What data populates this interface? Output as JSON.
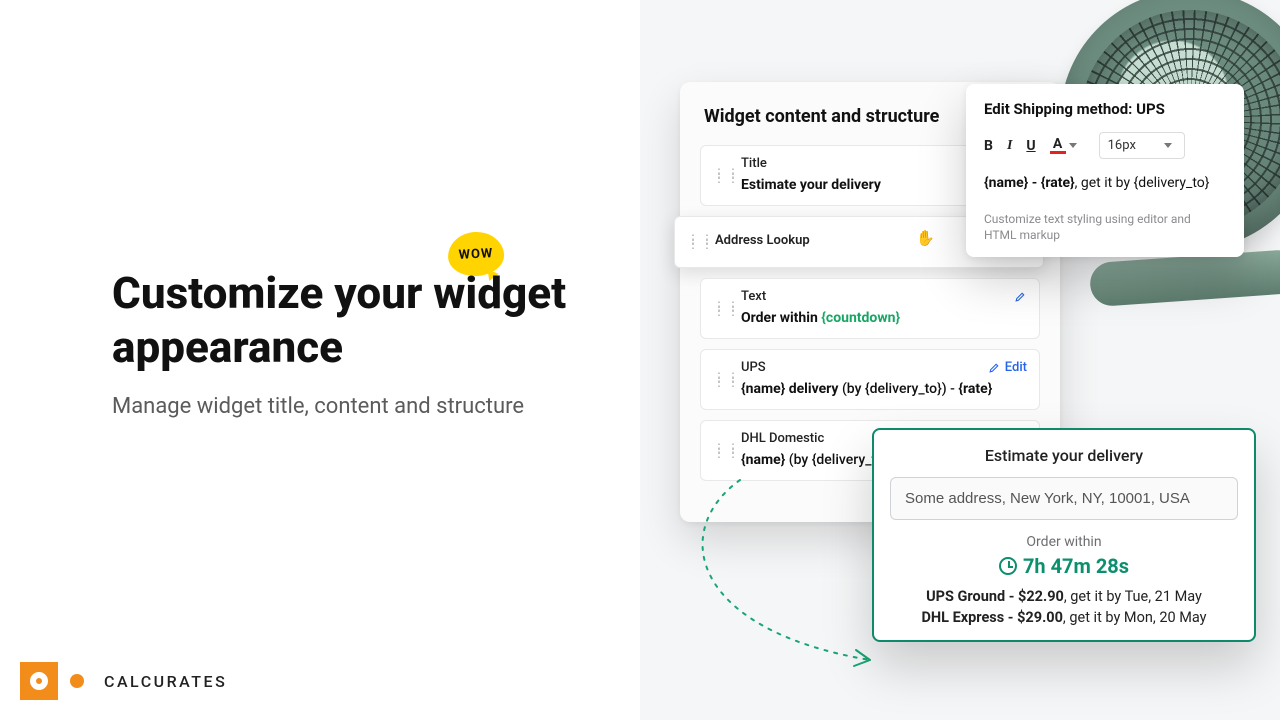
{
  "promo": {
    "wow_label": "WOW",
    "headline": "Customize your widget appearance",
    "subhead": "Manage widget title, content and structure",
    "brand": "CALCURATES"
  },
  "config": {
    "heading": "Widget content and structure",
    "edit_label": "Edit",
    "rows": [
      {
        "id": "title",
        "label": "Title",
        "body": "Estimate your delivery"
      },
      {
        "id": "address",
        "label": "Address Lookup"
      },
      {
        "id": "text",
        "label": "Text",
        "body_pre": "Order within ",
        "body_token": "{countdown}"
      },
      {
        "id": "ups",
        "label": "UPS",
        "body_html": "<span class='tpl-var'>{name} delivery</span> <span class='tpl-light'>(by {delivery_to}) -</span> <span class='tpl-var'>{rate}</span>"
      },
      {
        "id": "dhl",
        "label": "DHL Domestic",
        "body_html": "<span class='tpl-var'>{name}</span> <span class='tpl-light'>(by {delivery_to})</span>"
      }
    ]
  },
  "editor": {
    "title": "Edit Shipping method: UPS",
    "font_size": "16px",
    "body_bold": "{name} - {rate}",
    "body_rest": ", get it by {delivery_to}",
    "help": "Customize text styling using editor and HTML markup"
  },
  "preview": {
    "title": "Estimate your delivery",
    "address_value": "Some address, New York, NY, 10001, USA",
    "order_within_label": "Order within",
    "countdown": "7h 47m 28s",
    "lines": [
      {
        "bold": "UPS Ground - $22.90",
        "rest": ", get it by Tue, 21 May"
      },
      {
        "bold": "DHL Express - $29.00",
        "rest": ", get it by Mon, 20 May"
      }
    ]
  }
}
